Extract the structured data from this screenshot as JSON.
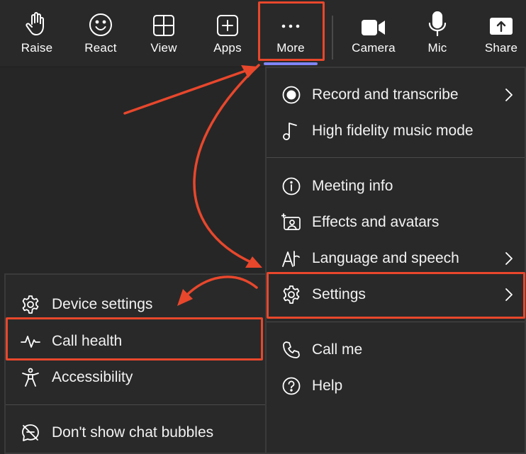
{
  "toolbar": {
    "raise": "Raise",
    "react": "React",
    "view": "View",
    "apps": "Apps",
    "more": "More",
    "camera": "Camera",
    "mic": "Mic",
    "share": "Share"
  },
  "more_menu": {
    "record": "Record and transcribe",
    "hifi": "High fidelity music mode",
    "meeting_info": "Meeting info",
    "effects": "Effects and avatars",
    "language": "Language and speech",
    "settings": "Settings",
    "call_me": "Call me",
    "help": "Help"
  },
  "settings_menu": {
    "device_settings": "Device settings",
    "call_health": "Call health",
    "accessibility": "Accessibility",
    "chat_bubbles": "Don't show chat bubbles"
  },
  "colors": {
    "highlight": "#e8472c",
    "accent": "#7f85f5",
    "background": "#262626"
  }
}
